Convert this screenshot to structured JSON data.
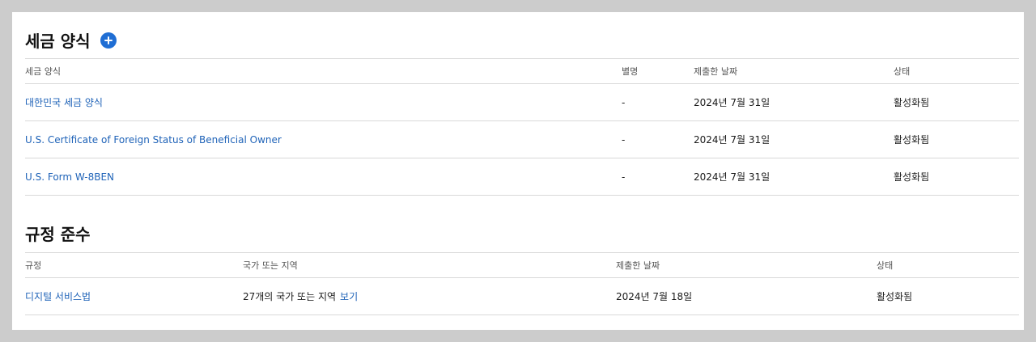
{
  "tax_forms": {
    "title": "세금 양식",
    "add_icon": "plus-circle-icon",
    "headers": {
      "form": "세금 양식",
      "alias": "별명",
      "submitted": "제출한 날짜",
      "status": "상태"
    },
    "rows": [
      {
        "form": "대한민국 세금 양식",
        "alias": "-",
        "submitted": "2024년 7월 31일",
        "status": "활성화됨"
      },
      {
        "form": "U.S. Certificate of Foreign Status of Beneficial Owner",
        "alias": "-",
        "submitted": "2024년 7월 31일",
        "status": "활성화됨"
      },
      {
        "form": "U.S. Form W-8BEN",
        "alias": "-",
        "submitted": "2024년 7월 31일",
        "status": "활성화됨"
      }
    ]
  },
  "compliance": {
    "title": "규정 준수",
    "headers": {
      "regulation": "규정",
      "regions": "국가 또는 지역",
      "submitted": "제출한 날짜",
      "status": "상태"
    },
    "rows": [
      {
        "regulation": "디지털 서비스법",
        "regions": "27개의 국가 또는 지역",
        "view_link": "보기",
        "submitted": "2024년 7월 18일",
        "status": "활성화됨"
      }
    ]
  },
  "colors": {
    "link": "#1f63b8",
    "accent": "#1f6ed4",
    "page_background": "#cccccc",
    "divider": "#d9d9d9"
  }
}
